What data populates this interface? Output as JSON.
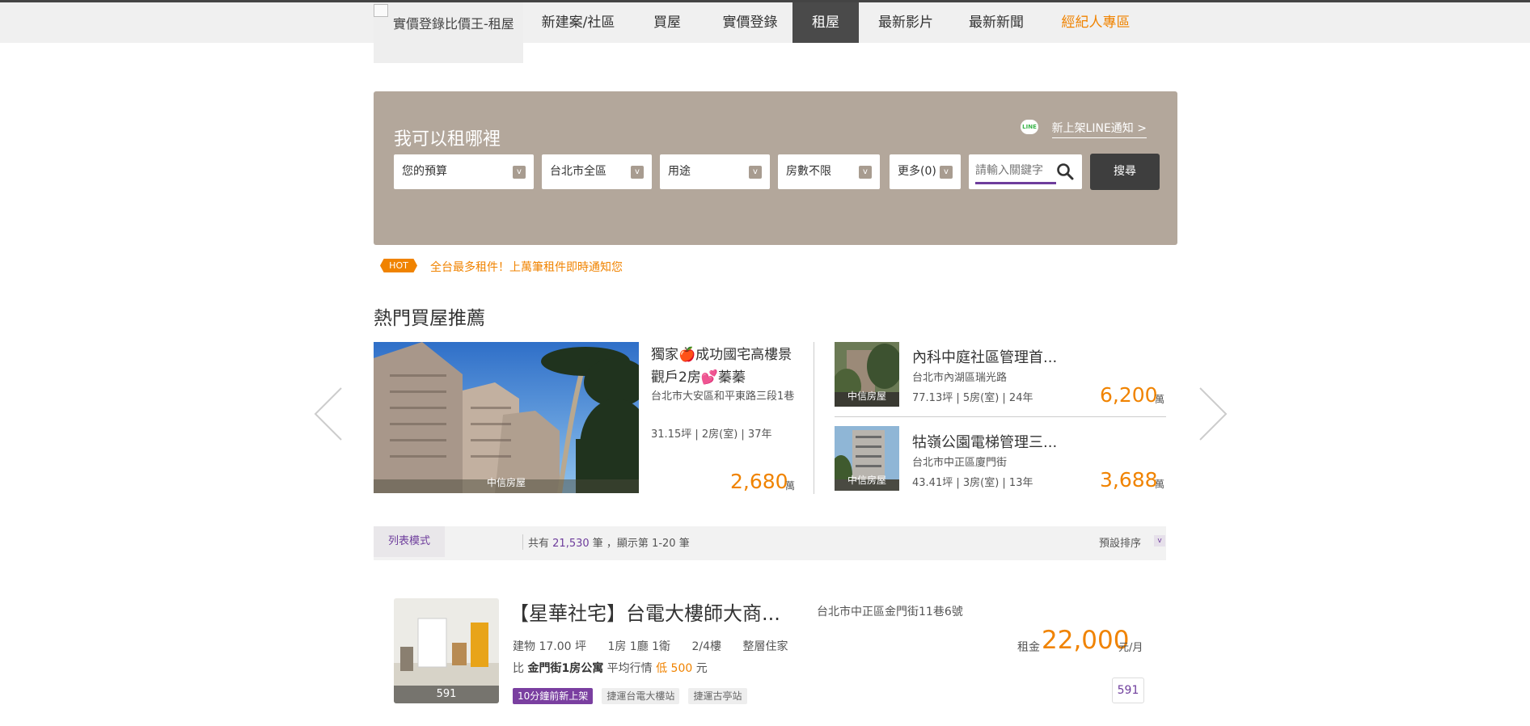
{
  "nav": {
    "logo": "實價登錄比價王-租屋",
    "items": [
      "新建案/社區",
      "買屋",
      "實價登錄",
      "租屋",
      "最新影片",
      "最新新聞",
      "經紀人專區"
    ]
  },
  "search": {
    "title": "我可以租哪裡",
    "line_notify": "新上架LINE通知 >",
    "line_icon": "LINE",
    "filters": [
      "您的預算",
      "台北市全區",
      "用途",
      "房數不限",
      "更多(0)"
    ],
    "dropdown_glyph": "v",
    "keyword_placeholder": "請輸入關鍵字",
    "button": "搜尋"
  },
  "hot": {
    "badge": "HOT",
    "text": "全台最多租件！上萬筆租件即時通知您"
  },
  "recommend": {
    "title": "熱門買屋推薦",
    "featured": {
      "title": "獨家🍎成功國宅高樓景觀戶2房💕蓁蓁",
      "address": "台北市大安區和平東路三段1巷",
      "spec": "31.15坪 | 2房(室) | 37年",
      "price": "2,680",
      "unit": "萬",
      "photo_tag": "中信房屋"
    },
    "side": [
      {
        "title": "內科中庭社區管理首...",
        "address": "台北市內湖區瑞光路",
        "spec": "77.13坪 | 5房(室) | 24年",
        "price": "6,200",
        "unit": "萬",
        "photo_tag": "中信房屋"
      },
      {
        "title": "牯嶺公園電梯管理三...",
        "address": "台北市中正區廈門街",
        "spec": "43.41坪 | 3房(室) | 13年",
        "price": "3,688",
        "unit": "萬",
        "photo_tag": "中信房屋"
      }
    ]
  },
  "list": {
    "tab": "列表模式",
    "count_prefix": "共有",
    "count": "21,530",
    "count_suffix": "筆 ，顯示第 1-20 筆",
    "sort": "預設排序",
    "sort_glyph": "v"
  },
  "listing": {
    "title": "【星華社宅】台電大樓師大商...",
    "address": "台北市中正區金門街11巷6號",
    "specs": [
      "建物 17.00 坪",
      "1房 1廳 1衛",
      "2/4樓",
      "整層住家"
    ],
    "compare_prefix": "比",
    "compare_target": "金門街1房公寓",
    "compare_mid": "平均行情",
    "compare_low": "低 500",
    "compare_unit": "元",
    "tags": [
      "10分鐘前新上架",
      "捷運台電大樓站",
      "捷運古亭站"
    ],
    "rent_label": "租金",
    "rent": "22,000",
    "rent_unit": "元/月",
    "source": "591",
    "photo_tag": "591"
  }
}
